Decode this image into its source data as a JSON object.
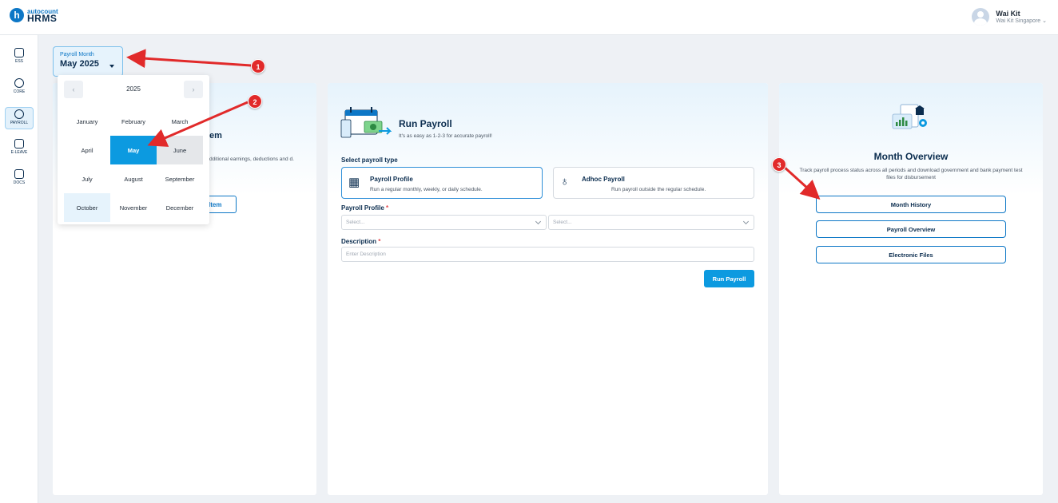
{
  "header": {
    "logo_top": "autocount",
    "logo_bottom": "HRMS",
    "logo_mark": "h",
    "user_name": "Wai Kit",
    "user_company": "Wai Kit Singapore"
  },
  "sidebar": {
    "items": [
      {
        "label": "ESS",
        "icon": "ess-icon"
      },
      {
        "label": "CORE",
        "icon": "core-icon"
      },
      {
        "label": "PAYROLL",
        "icon": "payroll-icon",
        "active": true
      },
      {
        "label": "E-LEAVE",
        "icon": "calendar-icon"
      },
      {
        "label": "DOCS",
        "icon": "docs-icon"
      }
    ]
  },
  "payroll_month": {
    "label": "Payroll Month",
    "value": "May 2025"
  },
  "month_picker": {
    "year": "2025",
    "prev": "‹",
    "next": "›",
    "months": [
      "January",
      "February",
      "March",
      "April",
      "May",
      "June",
      "July",
      "August",
      "September",
      "October",
      "November",
      "December"
    ],
    "selected": "May"
  },
  "left_card": {
    "title_fragment": "em",
    "desc_fragment": "dditional earnings, deductions and d.",
    "button_fragment": "Item"
  },
  "run_payroll": {
    "title": "Run Payroll",
    "subtitle": "It's as easy as 1-2-3 for accurate payroll!",
    "select_type_label": "Select payroll type",
    "types": [
      {
        "title": "Payroll Profile",
        "desc": "Run a regular monthly, weekly, or daily schedule."
      },
      {
        "title": "Adhoc Payroll",
        "desc": "Run payroll outside the regular schedule."
      }
    ],
    "profile_label": "Payroll Profile",
    "required_mark": "*",
    "select_placeholder": "Select...",
    "description_label": "Description",
    "description_placeholder": "Enter Description",
    "run_button": "Run Payroll"
  },
  "month_overview": {
    "title": "Month Overview",
    "desc": "Track payroll process status across all periods and download government and bank payment test files for disbursement",
    "buttons": [
      "Month History",
      "Payroll Overview",
      "Electronic Files"
    ]
  },
  "annotations": {
    "badges": [
      "1",
      "2",
      "3"
    ],
    "color": "#e12a2a"
  }
}
